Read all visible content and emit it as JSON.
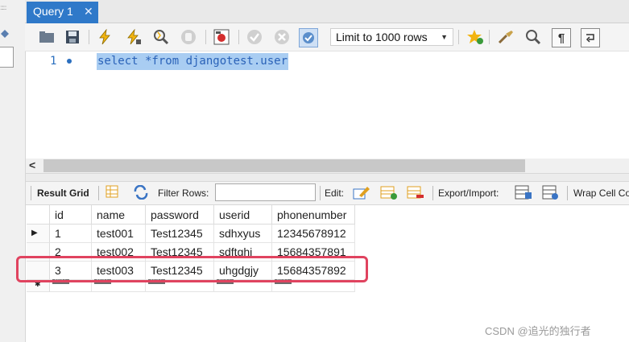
{
  "tab": {
    "title": "Query 1",
    "close": "✕"
  },
  "toolbar": {
    "icons": [
      "open-folder-icon",
      "save-icon",
      "execute-icon",
      "execute-current-icon",
      "explain-icon",
      "stop-icon",
      "toggle-results-icon",
      "commit-icon",
      "rollback-icon",
      "autocommit-icon",
      "bookmark-icon",
      "beautify-icon",
      "find-icon",
      "invisible-chars-icon",
      "wrap-icon"
    ],
    "limit_label": "Limit to 1000 rows"
  },
  "editor": {
    "line_number": "1",
    "sql": "select *from djangotest.user"
  },
  "scroll": {
    "left_arrow": "<"
  },
  "result_toolbar": {
    "result_grid": "Result Grid",
    "filter_rows": "Filter Rows:",
    "filter_value": "",
    "edit": "Edit:",
    "export_import": "Export/Import:",
    "wrap": "Wrap Cell Co"
  },
  "grid": {
    "columns": [
      "id",
      "name",
      "password",
      "userid",
      "phonenumber"
    ],
    "rows": [
      [
        "1",
        "test001",
        "Test12345",
        "sdhxyus",
        "12345678912"
      ],
      [
        "2",
        "test002",
        "Test12345",
        "sdftghj",
        "15684357891"
      ],
      [
        "3",
        "test003",
        "Test12345",
        "uhgdgjy",
        "15684357892"
      ]
    ],
    "null_label": "NULL",
    "current_row_marker": "▶",
    "new_row_marker": "✱"
  },
  "watermark": "CSDN @追光的独行者",
  "colors": {
    "tab_active": "#2f79c9",
    "highlight_border": "#e0435f",
    "sql_selection": "#a9cdf2",
    "sql_text": "#2a62b8"
  }
}
